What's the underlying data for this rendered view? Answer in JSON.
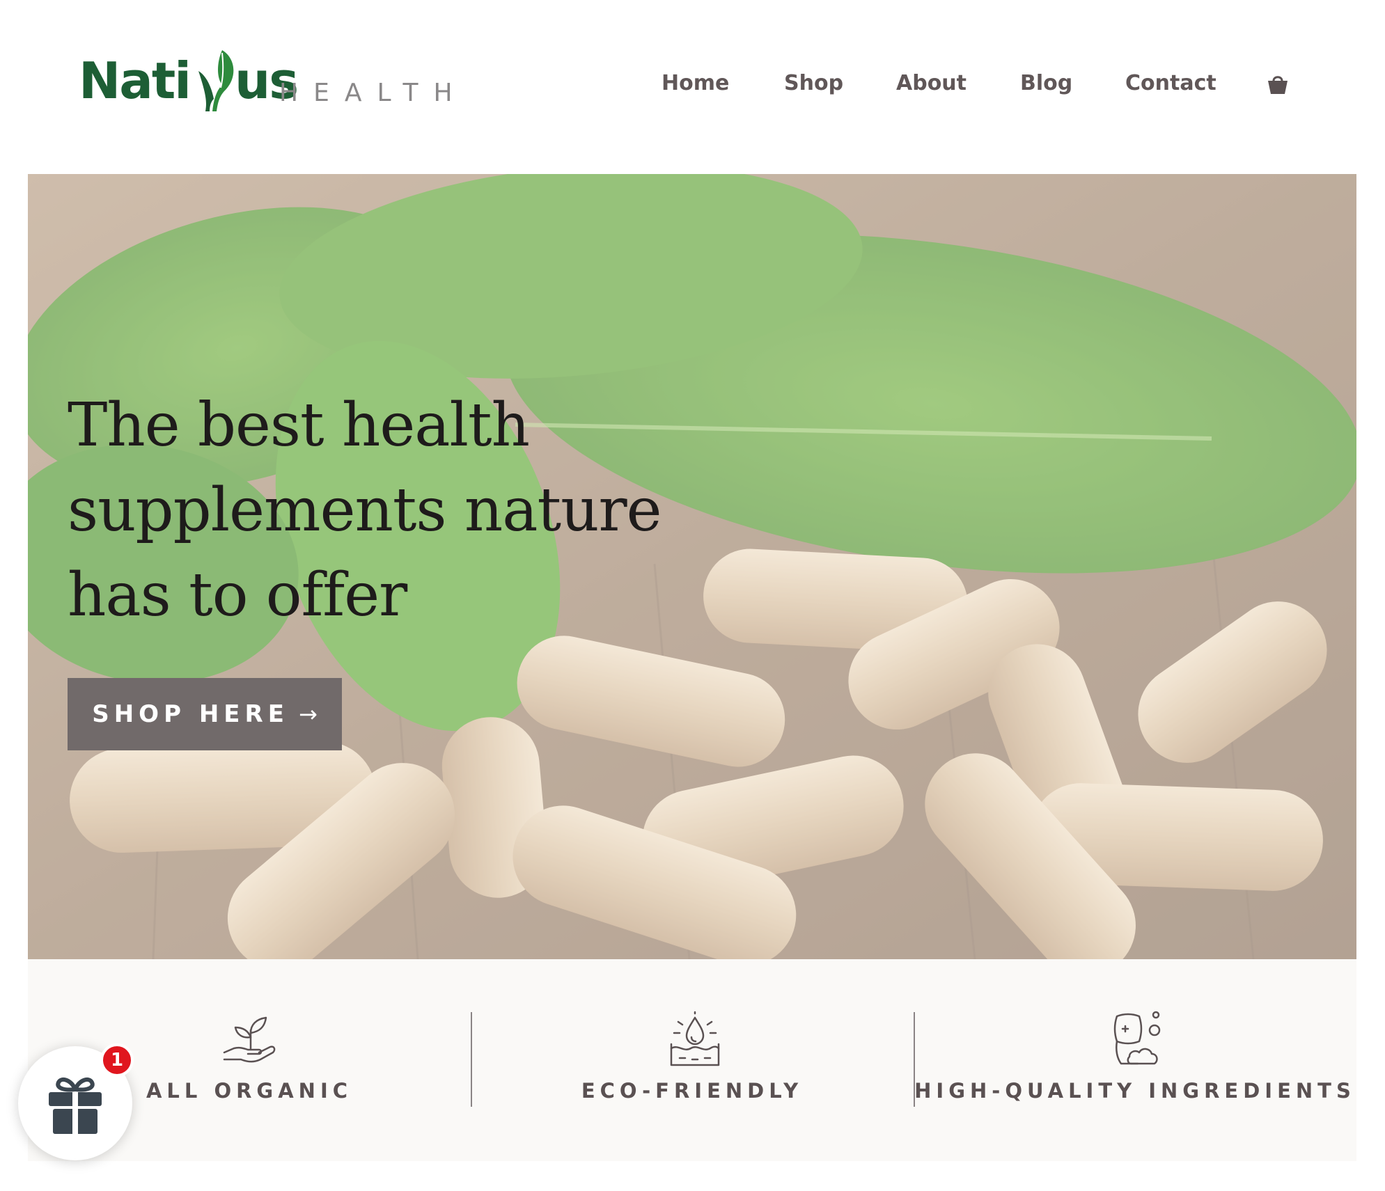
{
  "brand": {
    "name_part1": "Nati",
    "name_part2": "us",
    "suffix": "HEALTH",
    "primary_color": "#1d5e35"
  },
  "nav": {
    "items": [
      {
        "label": "Home"
      },
      {
        "label": "Shop"
      },
      {
        "label": "About"
      },
      {
        "label": "Blog"
      },
      {
        "label": "Contact"
      }
    ],
    "cart_icon": "shopping-basket-icon"
  },
  "hero": {
    "title": "The best health supplements nature has to offer",
    "button_label": "SHOP HERE",
    "button_icon": "arrow-right-icon",
    "button_color": "#716a6a"
  },
  "features": [
    {
      "label": "ALL ORGANIC",
      "icon": "plant-in-hand-icon"
    },
    {
      "label": "ECO-FRIENDLY",
      "icon": "water-drop-icon"
    },
    {
      "label": "HIGH-QUALITY INGREDIENTS",
      "icon": "clean-skin-icon"
    }
  ],
  "gift_widget": {
    "icon": "gift-icon",
    "badge_count": "1",
    "badge_color": "#e0161e"
  }
}
